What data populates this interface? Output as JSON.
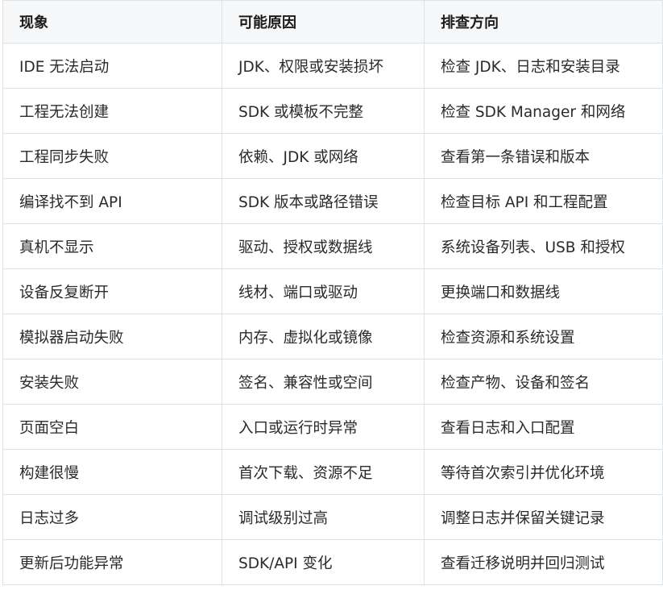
{
  "table": {
    "headers": [
      "现象",
      "可能原因",
      "排查方向"
    ],
    "rows": [
      [
        "IDE 无法启动",
        "JDK、权限或安装损坏",
        "检查 JDK、日志和安装目录"
      ],
      [
        "工程无法创建",
        "SDK 或模板不完整",
        "检查 SDK Manager 和网络"
      ],
      [
        "工程同步失败",
        "依赖、JDK 或网络",
        "查看第一条错误和版本"
      ],
      [
        "编译找不到 API",
        "SDK 版本或路径错误",
        "检查目标 API 和工程配置"
      ],
      [
        "真机不显示",
        "驱动、授权或数据线",
        "系统设备列表、USB 和授权"
      ],
      [
        "设备反复断开",
        "线材、端口或驱动",
        "更换端口和数据线"
      ],
      [
        "模拟器启动失败",
        "内存、虚拟化或镜像",
        "检查资源和系统设置"
      ],
      [
        "安装失败",
        "签名、兼容性或空间",
        "检查产物、设备和签名"
      ],
      [
        "页面空白",
        "入口或运行时异常",
        "查看日志和入口配置"
      ],
      [
        "构建很慢",
        "首次下载、资源不足",
        "等待首次索引并优化环境"
      ],
      [
        "日志过多",
        "调试级别过高",
        "调整日志并保留关键记录"
      ],
      [
        "更新后功能异常",
        "SDK/API 变化",
        "查看迁移说明并回归测试"
      ]
    ]
  }
}
